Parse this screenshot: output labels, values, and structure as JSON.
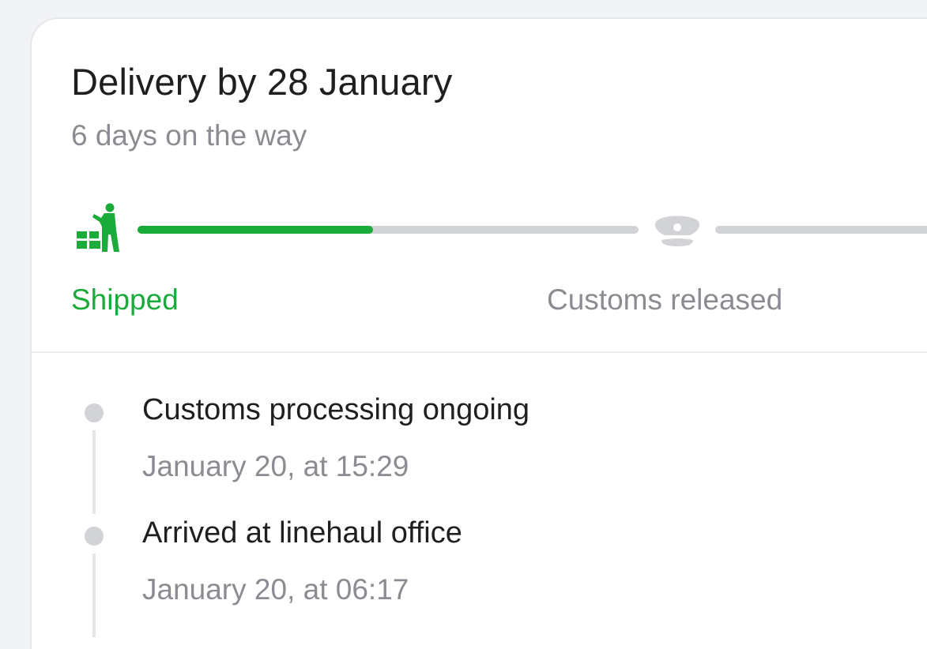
{
  "delivery": {
    "title": "Delivery by 28 January",
    "subtitle": "6 days on the way"
  },
  "progress": {
    "fraction": 0.47,
    "steps": [
      {
        "label": "Shipped",
        "icon": "shipped-worker-icon",
        "state": "done"
      },
      {
        "label": "Customs released",
        "icon": "customs-officer-cap-icon",
        "state": "pending"
      }
    ]
  },
  "timeline": {
    "events": [
      {
        "title": "Customs processing ongoing",
        "time": "January 20, at 15:29"
      },
      {
        "title": "Arrived at linehaul office",
        "time": "January 20, at 06:17"
      }
    ]
  },
  "colors": {
    "accent": "#1aab3a",
    "muted": "#8b8c91",
    "track": "#d2d3d7"
  }
}
